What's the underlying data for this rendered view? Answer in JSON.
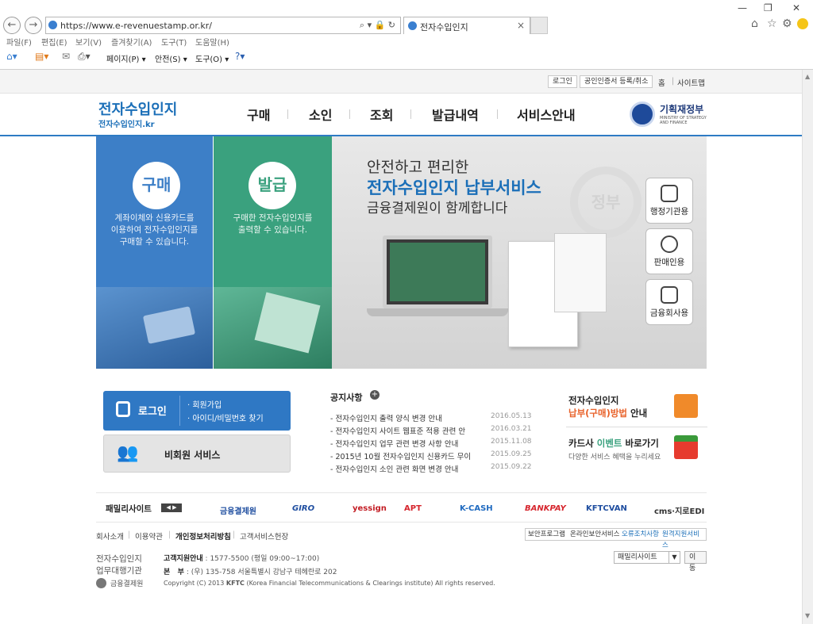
{
  "browser": {
    "url": "https://www.e-revenuestamp.or.kr/",
    "tab_title": "전자수입인지",
    "menu": [
      "파일(F)",
      "편집(E)",
      "보기(V)",
      "즐겨찾기(A)",
      "도구(T)",
      "도움말(H)"
    ],
    "commands": [
      "페이지(P) ▾",
      "안전(S) ▾",
      "도구(O) ▾"
    ]
  },
  "util": {
    "login": "로그인",
    "cert": "공인인증서 등록/취소",
    "home": "홈",
    "sitemap": "사이트맵"
  },
  "header": {
    "logo_title": "전자수입인지",
    "logo_sub": "전자수입인지.kr",
    "nav": [
      "구매",
      "소인",
      "조회",
      "발급내역",
      "서비스안내"
    ],
    "ministry": "기획재정부",
    "ministry_en": "MINISTRY OF STRATEGY AND FINANCE"
  },
  "hero": {
    "buy_label": "구매",
    "buy_text": "계좌이체와 신용카드를\n이용하여 전자수입인지를\n구매할 수 있습니다.",
    "issue_label": "발급",
    "issue_text": "구매한 전자수입인지를\n출력할 수 있습니다.",
    "title1": "안전하고 편리한",
    "title2": "전자수입인지 납부서비스",
    "title3": "금융결제원이 함께합니다",
    "seal": "정부",
    "side_buttons": [
      "행정기관용",
      "판매인용",
      "금융회사용"
    ]
  },
  "login_box": {
    "login": "로그인",
    "join": "· 회원가입",
    "find": "· 아이디/비밀번호 찾기"
  },
  "guest_box": {
    "label": "비회원 서비스"
  },
  "notice": {
    "title": "공지사항",
    "items": [
      {
        "text": "- 전자수입인지 출력 양식 변경 안내",
        "date": "2016.05.13"
      },
      {
        "text": "- 전자수입인지 사이트 웹표준 적용 관련 안",
        "date": "2016.03.21"
      },
      {
        "text": "- 전자수입인지 업무 관련 변경 사항 안내",
        "date": "2015.11.08"
      },
      {
        "text": "- 2015년 10월 전자수입인지 신용카드 무이",
        "date": "2015.09.25"
      },
      {
        "text": "- 전자수입인지 소인 관련 화면 변경 안내",
        "date": "2015.09.22"
      }
    ]
  },
  "promo": {
    "a_line1": "전자수입인지",
    "a_line2": "납부(구매)방법",
    "a_line2b": " 안내",
    "b_line1a": "카드사 ",
    "b_line1b": "이벤트",
    "b_line1c": " 바로가기",
    "b_line2": "다양한 서비스 혜택을 누리세요"
  },
  "family": {
    "title": "패밀리사이트",
    "sites": [
      "금융결제원",
      "GIRO",
      "yessign",
      "APT",
      "K-CASH",
      "BANKPAY",
      "KFTCVAN",
      "cms·지로EDI"
    ]
  },
  "footer": {
    "links": [
      "회사소개",
      "이용약관",
      "개인정보처리방침",
      "고객서비스헌장"
    ],
    "buttons": [
      "보안프로그램",
      "온라인보안서비스",
      "오류조치사항",
      "원격지원서비스"
    ],
    "org1": "전자수입인지",
    "org2": "업무대행기관",
    "org3": "금융결제원",
    "cs_label": "고객지원안내",
    "cs_value": " : 1577-5500 (평일 09:00~17:00)",
    "hq_label": "본   부",
    "hq_value": " : (우) 135-758 서울특별시 강남구 테헤란로 202",
    "copyright_pre": "Copyright (C) 2013 ",
    "copyright_org": "KFTC",
    "copyright_post": " (Korea Financial Telecommunications & Clearings institute) All rights reserved.",
    "family_select": "패밀리사이트",
    "go": "이동"
  },
  "colors": {
    "blue": "#3d7fc7",
    "green": "#3aa17e",
    "accent": "#1b6fb8"
  }
}
